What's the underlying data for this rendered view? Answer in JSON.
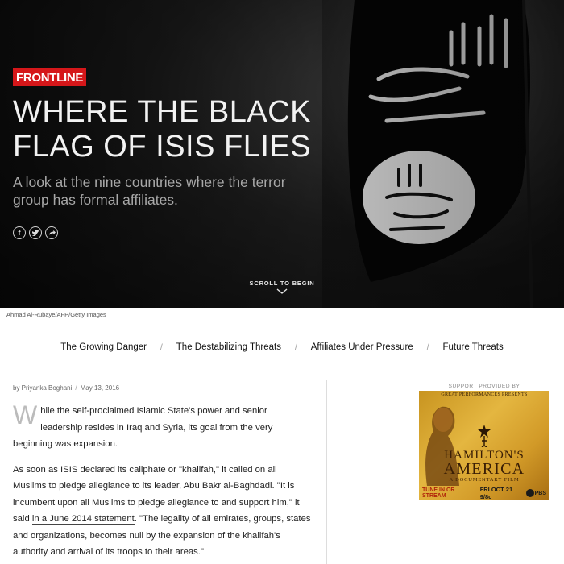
{
  "hero": {
    "logo": "FRONTLINE",
    "title": "WHERE THE BLACK FLAG OF ISIS FLIES",
    "subtitle": "A look at the nine countries where the terror group has formal affiliates.",
    "share_icons": [
      "facebook-icon",
      "twitter-icon",
      "share-icon"
    ],
    "scroll_label": "SCROLL TO BEGIN"
  },
  "photo_credit": "Ahmad Al-Rubaye/AFP/Getty Images",
  "nav": {
    "items": [
      {
        "label": "The Growing Danger"
      },
      {
        "label": "The Destabilizing Threats"
      },
      {
        "label": "Affiliates Under Pressure"
      },
      {
        "label": "Future Threats"
      }
    ],
    "separator": "/"
  },
  "byline": {
    "author": "by Priyanka Boghani",
    "date": "May 13, 2016"
  },
  "article": {
    "p1_dropcap": "W",
    "p1_rest": "hile the self-proclaimed Islamic State's power and senior leadership resides in Iraq and Syria, its goal from the very beginning was expansion.",
    "p2_before": "As soon as ISIS declared its caliphate or \"khalifah,\" it called on all Muslims to pledge allegiance to its leader, Abu Bakr al-Baghdadi. \"It is incumbent upon all Muslims to pledge allegiance to and support him,\" it said ",
    "p2_link": "in a June 2014 statement",
    "p2_after": ". \"The legality of all emirates, groups, states and organizations, becomes null by the expansion of the khalifah's authority and arrival of its troops to their areas.\""
  },
  "sidebar": {
    "support_label": "SUPPORT PROVIDED BY",
    "ad": {
      "presenter": "GREAT PERFORMANCES PRESENTS",
      "title_line1": "HAMILTON'S",
      "title_line2": "AMERICA",
      "subtitle": "A DOCUMENTARY FILM",
      "tune_in": "TUNE IN OR STREAM",
      "airdate": "FRI OCT 21 9/8c",
      "network": "PBS"
    }
  },
  "colors": {
    "frontline_red": "#d5171a",
    "hero_bg": "#111111",
    "ad_gold": "#d9a832"
  }
}
